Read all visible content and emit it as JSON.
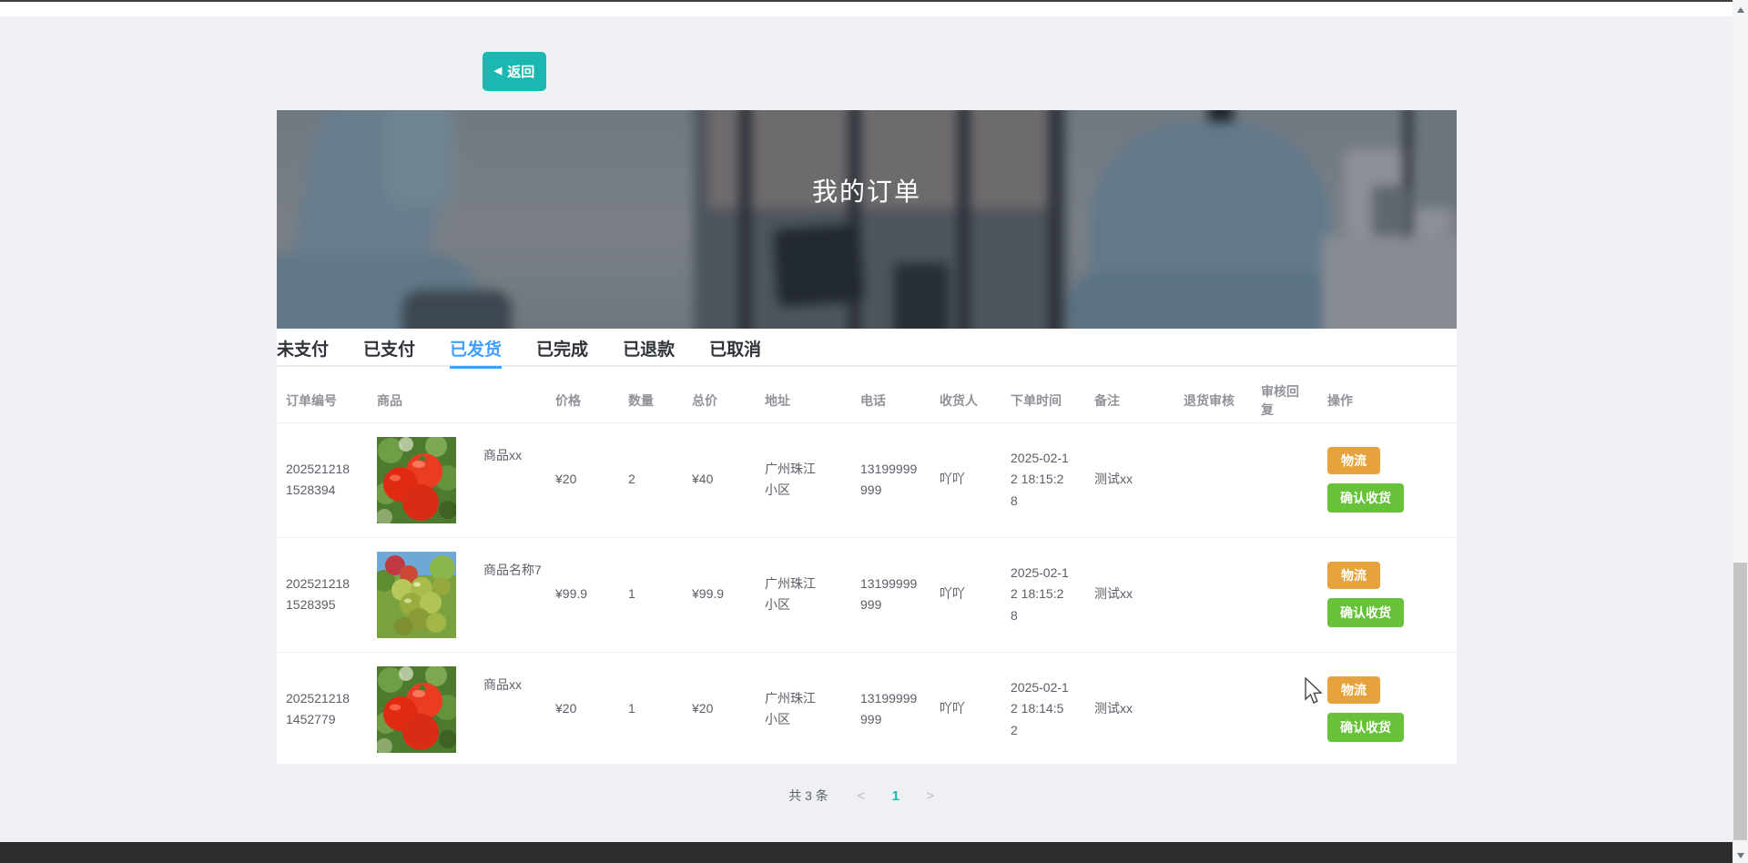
{
  "window": {
    "back_button_label": "返回",
    "back_button_icon": "◀"
  },
  "banner": {
    "title": "我的订单"
  },
  "tabs": [
    {
      "label": "未支付",
      "active": false
    },
    {
      "label": "已支付",
      "active": false
    },
    {
      "label": "已发货",
      "active": true
    },
    {
      "label": "已完成",
      "active": false
    },
    {
      "label": "已退款",
      "active": false
    },
    {
      "label": "已取消",
      "active": false
    }
  ],
  "table": {
    "headers": [
      "订单编号",
      "商品",
      "价格",
      "数量",
      "总价",
      "地址",
      "电话",
      "收货人",
      "下单时间",
      "备注",
      "退货审核",
      "审核回复",
      "操作"
    ],
    "action_labels": {
      "logistics": "物流",
      "confirm_receipt": "确认收货"
    },
    "rows": [
      {
        "order_no": "2025212181528394",
        "product_name": "商品xx",
        "product_image": "tomatoes",
        "price": "¥20",
        "quantity": "2",
        "total": "¥40",
        "address": "广州珠江小区",
        "phone": "13199999999",
        "consignee": "吖吖",
        "order_time": "2025-02-12 18:15:28",
        "remark": "测试xx",
        "return_review": "",
        "review_reply": ""
      },
      {
        "order_no": "2025212181528395",
        "product_name": "商品名称7",
        "product_image": "grapes",
        "price": "¥99.9",
        "quantity": "1",
        "total": "¥99.9",
        "address": "广州珠江小区",
        "phone": "13199999999",
        "consignee": "吖吖",
        "order_time": "2025-02-12 18:15:28",
        "remark": "测试xx",
        "return_review": "",
        "review_reply": ""
      },
      {
        "order_no": "2025212181452779",
        "product_name": "商品xx",
        "product_image": "tomatoes",
        "price": "¥20",
        "quantity": "1",
        "total": "¥20",
        "address": "广州珠江小区",
        "phone": "13199999999",
        "consignee": "吖吖",
        "order_time": "2025-02-12 18:14:52",
        "remark": "测试xx",
        "return_review": "",
        "review_reply": ""
      }
    ]
  },
  "pagination": {
    "total_text": "共 3 条",
    "prev_icon": "<",
    "current_page": "1",
    "next_icon": ">"
  },
  "colors": {
    "accent_teal": "#1ab8b0",
    "tab_active_blue": "#409eff",
    "warning_orange": "#e6a23c",
    "success_green": "#67c23a",
    "footer_dark": "#2a2c2e"
  }
}
